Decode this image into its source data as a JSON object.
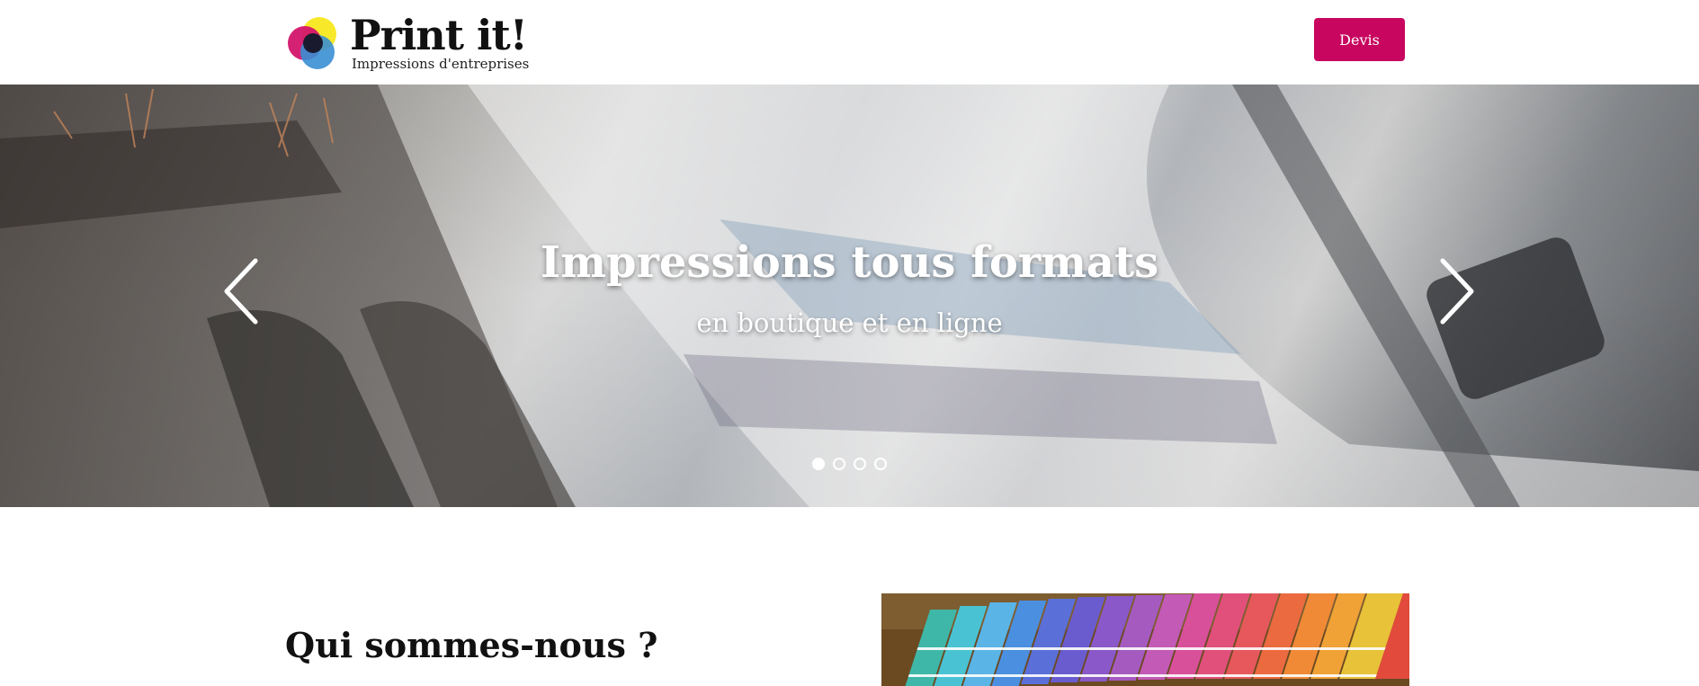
{
  "header": {
    "logo_title": "Print it!",
    "logo_subtitle": "Impressions d'entreprises",
    "devis_label": "Devis"
  },
  "hero": {
    "title": "Impressions tous formats",
    "subtitle": "en boutique et en ligne",
    "slides_count": 4,
    "active_slide": 1
  },
  "about": {
    "title": "Qui sommes-nous ?"
  },
  "colors": {
    "brand_accent": "#c8065f",
    "logo_magenta": "#d3156b",
    "logo_yellow": "#f7e92a",
    "logo_cyan": "#3a8fd4",
    "logo_dark": "#1a1a2e",
    "text": "#111111"
  },
  "icons": {
    "prev": "chevron-left-icon",
    "next": "chevron-right-icon",
    "logo": "cmyk-circles-icon"
  }
}
